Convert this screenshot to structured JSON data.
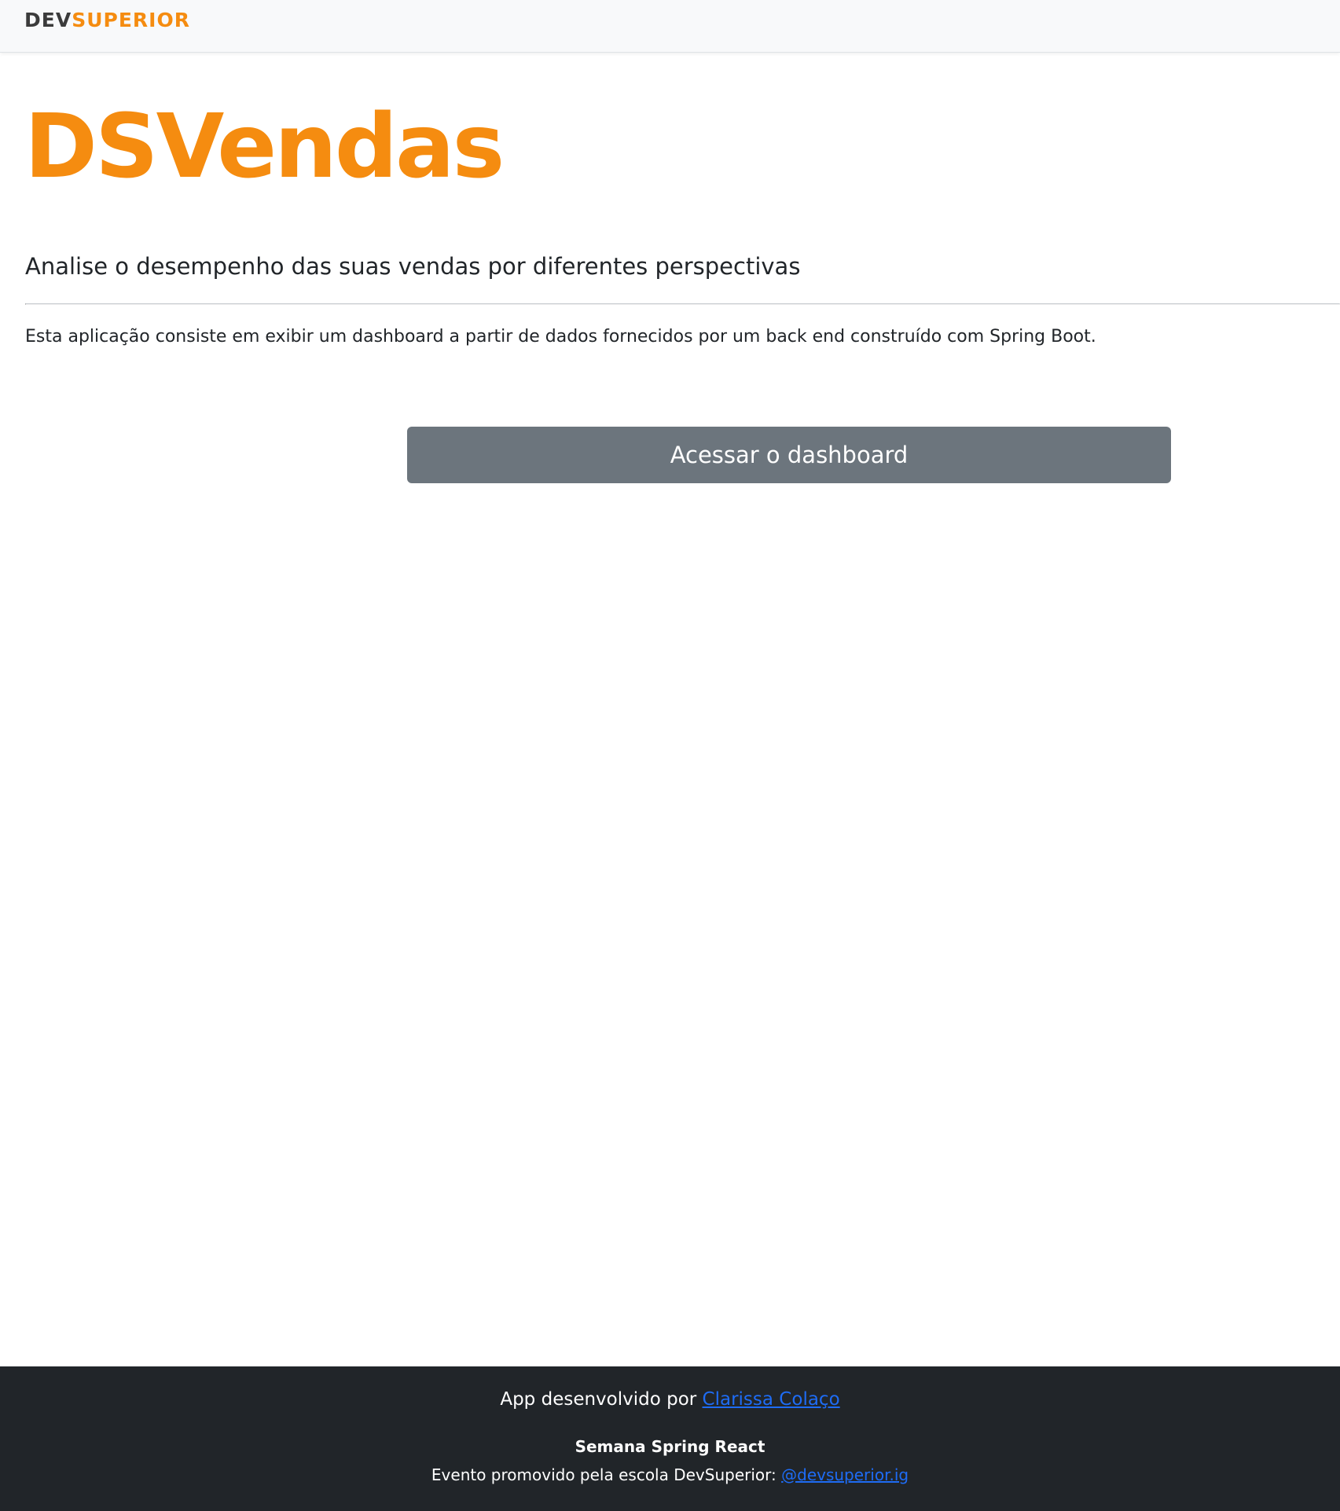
{
  "navbar": {
    "logo_dev": "DEV",
    "logo_superior": "SUPERIOR"
  },
  "main": {
    "title": "DSVendas",
    "lead": "Analise o desempenho das suas vendas por diferentes perspectivas",
    "description": "Esta aplicação consiste em exibir um dashboard a partir de dados fornecidos por um back end construído com Spring Boot.",
    "button_label": "Acessar o dashboard"
  },
  "footer": {
    "credit_prefix": "App desenvolvido por ",
    "credit_name": "Clarissa Colaço",
    "event_title": "Semana Spring React",
    "event_prefix": "Evento promovido pela escola DevSuperior: ",
    "event_link": "@devsuperior.ig"
  },
  "colors": {
    "brand_orange": "#f58c10",
    "navbar_bg": "#f8f9fa",
    "button_bg": "#6c757d",
    "footer_bg": "#212529",
    "link": "#1e6cf5"
  }
}
